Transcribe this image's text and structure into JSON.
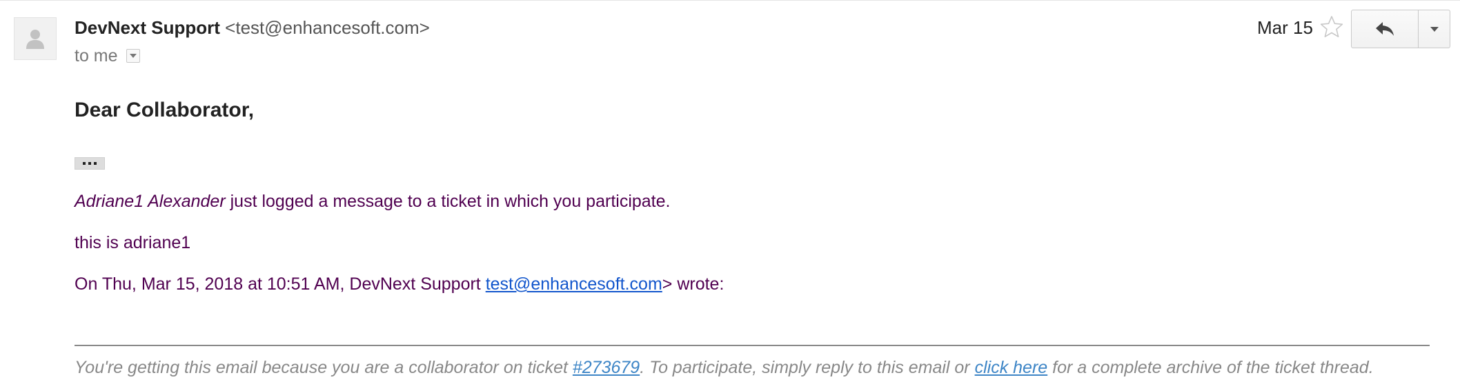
{
  "message": {
    "sender_name": "DevNext Support",
    "sender_email": "<test@enhancesoft.com>",
    "to_label": "to me",
    "date": "Mar 15",
    "starred": false
  },
  "actions": {
    "reply_icon": "reply-arrow-icon",
    "more_icon": "caret-down-icon",
    "star_icon": "star-outline-icon",
    "avatar_icon": "person-silhouette-icon"
  },
  "body": {
    "greeting": "Dear Collaborator,",
    "author": "Adriane1 Alexander",
    "action_text": " just logged a message to a ticket in which you participate.",
    "message_text": "this is adriane1",
    "quote_prefix": "On Thu, Mar 15, 2018 at 10:51 AM, DevNext Support ",
    "quote_email": "test@enhancesoft.com",
    "quote_suffix": "> wrote:"
  },
  "footer": {
    "text_before_ticket": "You're getting this email because you are a collaborator on ticket ",
    "ticket_link": "#273679",
    "text_middle": ". To participate, simply reply to this email or ",
    "archive_link": "click here",
    "text_after": " for a complete archive of the ticket thread."
  },
  "colors": {
    "body_text": "#500050",
    "link": "#1155cc",
    "footer_text": "#888888",
    "footer_link": "#3d85c6"
  }
}
